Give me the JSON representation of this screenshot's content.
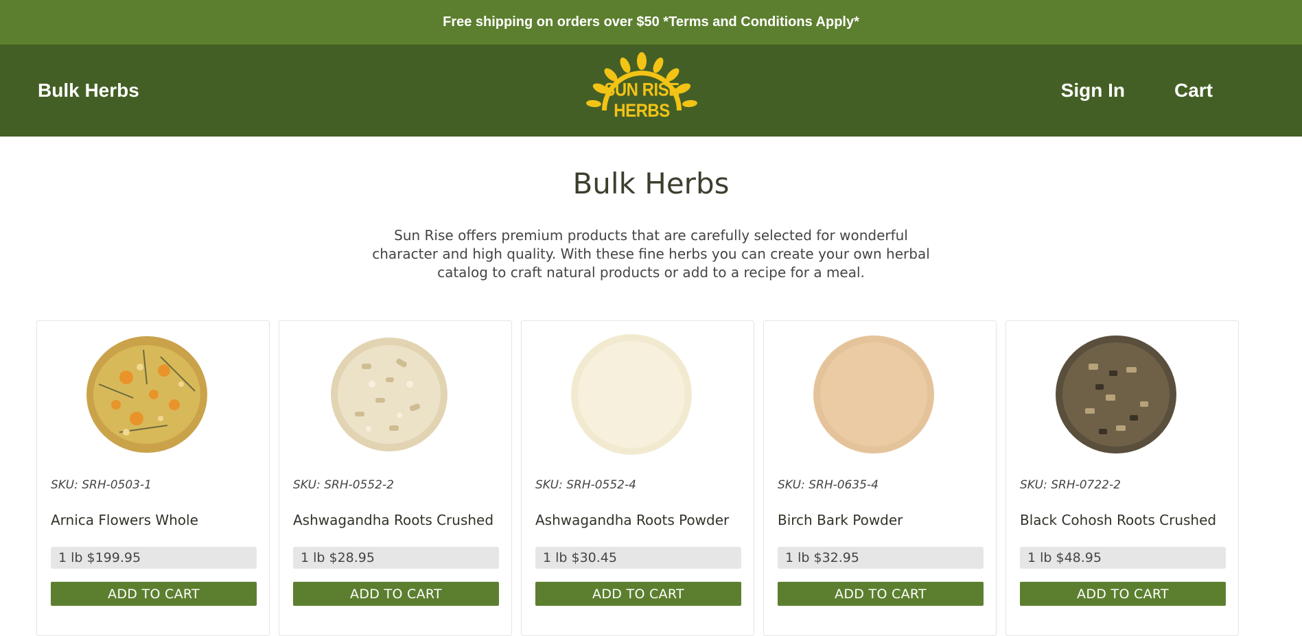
{
  "announcement": "Free shipping on orders over $50 *Terms and Conditions Apply*",
  "header": {
    "nav_left": "Bulk Herbs",
    "logo_text": "SUN RISE HERBS",
    "sign_in": "Sign In",
    "cart": "Cart"
  },
  "colors": {
    "announce_bg": "#5c7f2f",
    "header_bg": "#445f25",
    "logo_yellow": "#f3c316",
    "button_green": "#5c7f2f"
  },
  "main": {
    "title": "Bulk Herbs",
    "intro": "Sun Rise offers premium products that are carefully selected for wonderful character and high quality. With these fine herbs you can create your own herbal catalog to craft natural products or add to a recipe for a meal."
  },
  "products": [
    {
      "sku": "SKU: SRH-0503-1",
      "name": "Arnica Flowers Whole",
      "price": "1 lb $199.95",
      "button": "ADD TO CART",
      "image": "arnica-flowers-image"
    },
    {
      "sku": "SKU: SRH-0552-2",
      "name": "Ashwagandha Roots Crushed",
      "price": "1 lb $28.95",
      "button": "ADD TO CART",
      "image": "ashwagandha-crushed-image"
    },
    {
      "sku": "SKU: SRH-0552-4",
      "name": "Ashwagandha Roots Powder",
      "price": "1 lb $30.45",
      "button": "ADD TO CART",
      "image": "ashwagandha-powder-image"
    },
    {
      "sku": "SKU: SRH-0635-4",
      "name": "Birch Bark Powder",
      "price": "1 lb $32.95",
      "button": "ADD TO CART",
      "image": "birch-bark-powder-image"
    },
    {
      "sku": "SKU: SRH-0722-2",
      "name": "Black Cohosh Roots Crushed",
      "price": "1 lb $48.95",
      "button": "ADD TO CART",
      "image": "black-cohosh-crushed-image"
    }
  ]
}
